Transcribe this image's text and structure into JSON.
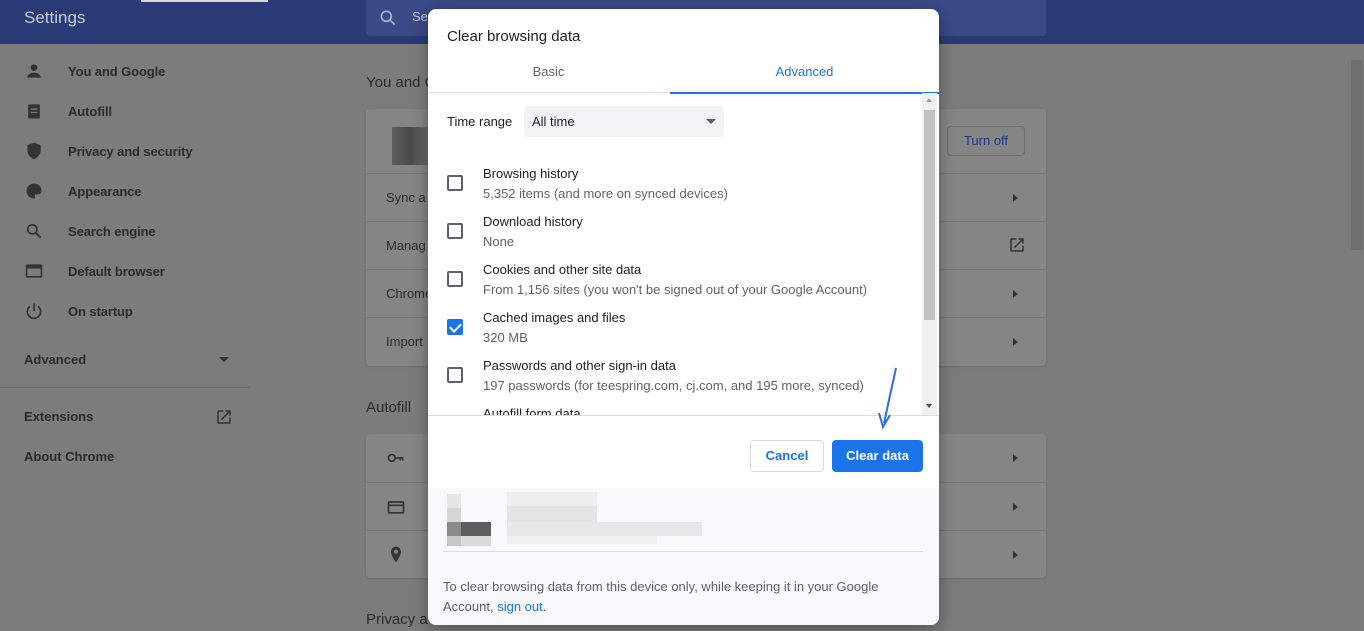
{
  "settings": {
    "title": "Settings",
    "search_placeholder": "Se",
    "sidebar": {
      "items": [
        {
          "label": "You and Google",
          "icon": "person-icon"
        },
        {
          "label": "Autofill",
          "icon": "clipboard-icon"
        },
        {
          "label": "Privacy and security",
          "icon": "shield-icon"
        },
        {
          "label": "Appearance",
          "icon": "palette-icon"
        },
        {
          "label": "Search engine",
          "icon": "search-icon"
        },
        {
          "label": "Default browser",
          "icon": "browser-icon"
        },
        {
          "label": "On startup",
          "icon": "power-icon"
        }
      ],
      "advanced": "Advanced",
      "extensions": "Extensions",
      "about": "About Chrome"
    },
    "sections": {
      "you_and_google": "You and G",
      "autofill": "Autofill",
      "privacy": "Privacy a"
    },
    "you_rows": [
      "Sync a",
      "Manag",
      "Chrome",
      "Import"
    ],
    "turn_off": "Turn off"
  },
  "dialog": {
    "title": "Clear browsing data",
    "tabs": {
      "basic": "Basic",
      "advanced": "Advanced"
    },
    "time_range_label": "Time range",
    "time_range_value": "All time",
    "options": [
      {
        "title": "Browsing history",
        "desc": "5,352 items (and more on synced devices)",
        "checked": false
      },
      {
        "title": "Download history",
        "desc": "None",
        "checked": false
      },
      {
        "title": "Cookies and other site data",
        "desc": "From 1,156 sites (you won't be signed out of your Google Account)",
        "checked": false
      },
      {
        "title": "Cached images and files",
        "desc": "320 MB",
        "checked": true
      },
      {
        "title": "Passwords and other sign-in data",
        "desc": "197 passwords (for teespring.com, cj.com, and 195 more, synced)",
        "checked": false
      },
      {
        "title": "Autofill form data",
        "desc": "",
        "checked": false
      }
    ],
    "cancel_label": "Cancel",
    "clear_label": "Clear data",
    "account_note": "To clear browsing data from this device only, while keeping it in your Google Account,",
    "sign_out": "sign out",
    "note_end": "."
  },
  "colors": {
    "accent": "#1a73e8",
    "header_dim": "#2a3a77",
    "page_dim": "#7c7c7c"
  }
}
